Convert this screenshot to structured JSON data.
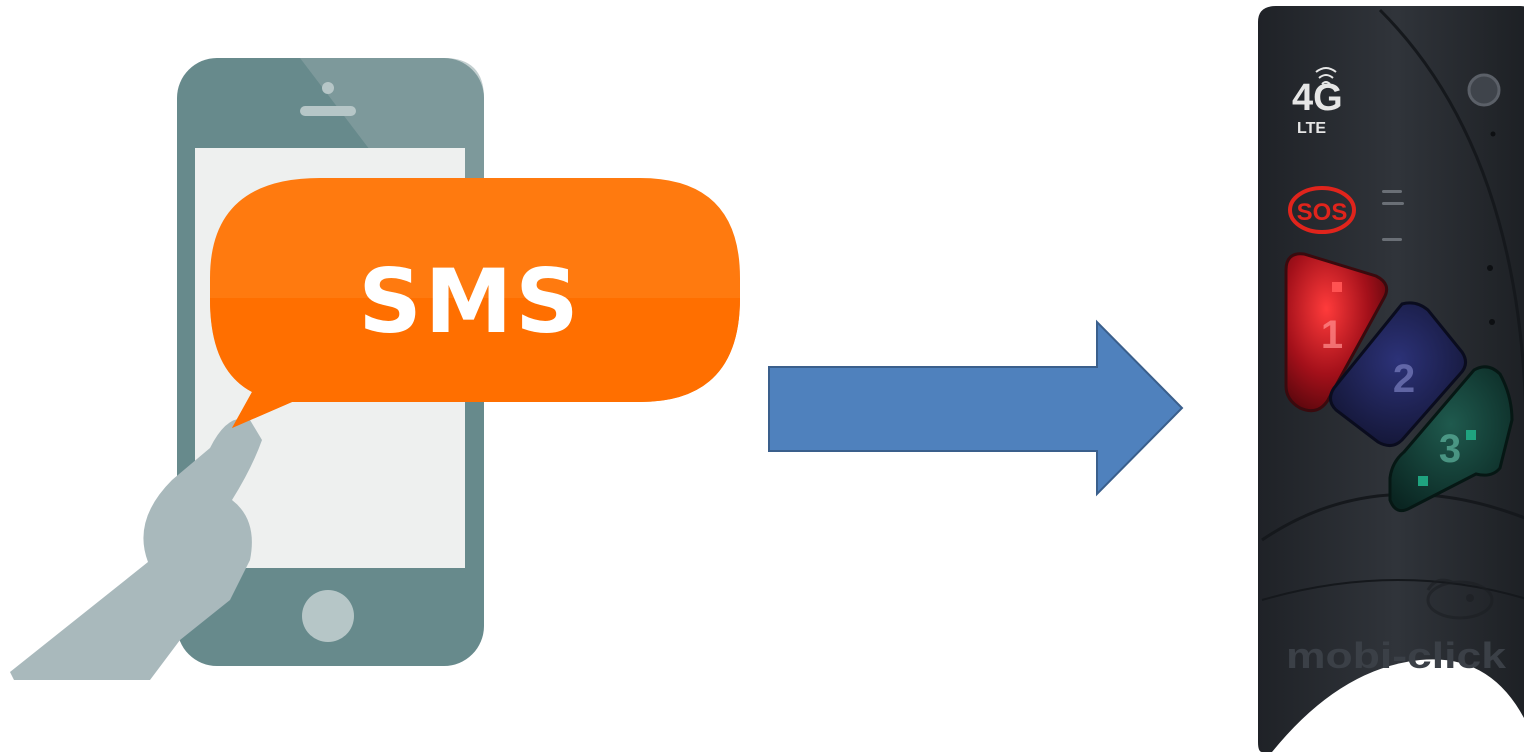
{
  "sms_bubble": {
    "label": "SMS"
  },
  "device": {
    "network_label": "4G",
    "network_sub_label": "LTE",
    "sos_label": "SOS",
    "brand_label": "mobi-click",
    "buttons": [
      {
        "label": "1",
        "color": "#b3121b"
      },
      {
        "label": "2",
        "color": "#1c1f4a"
      },
      {
        "label": "3",
        "color": "#0f3a33"
      }
    ]
  },
  "colors": {
    "phone_body": "#678a8c",
    "phone_screen": "#eef0ef",
    "hand": "#a9b9bc",
    "bubble": "#ff7a0f",
    "arrow": "#4f81bd",
    "arrow_stroke": "#3a5f8c",
    "device_body": "#2b2f35",
    "sos": "#e0241c"
  }
}
